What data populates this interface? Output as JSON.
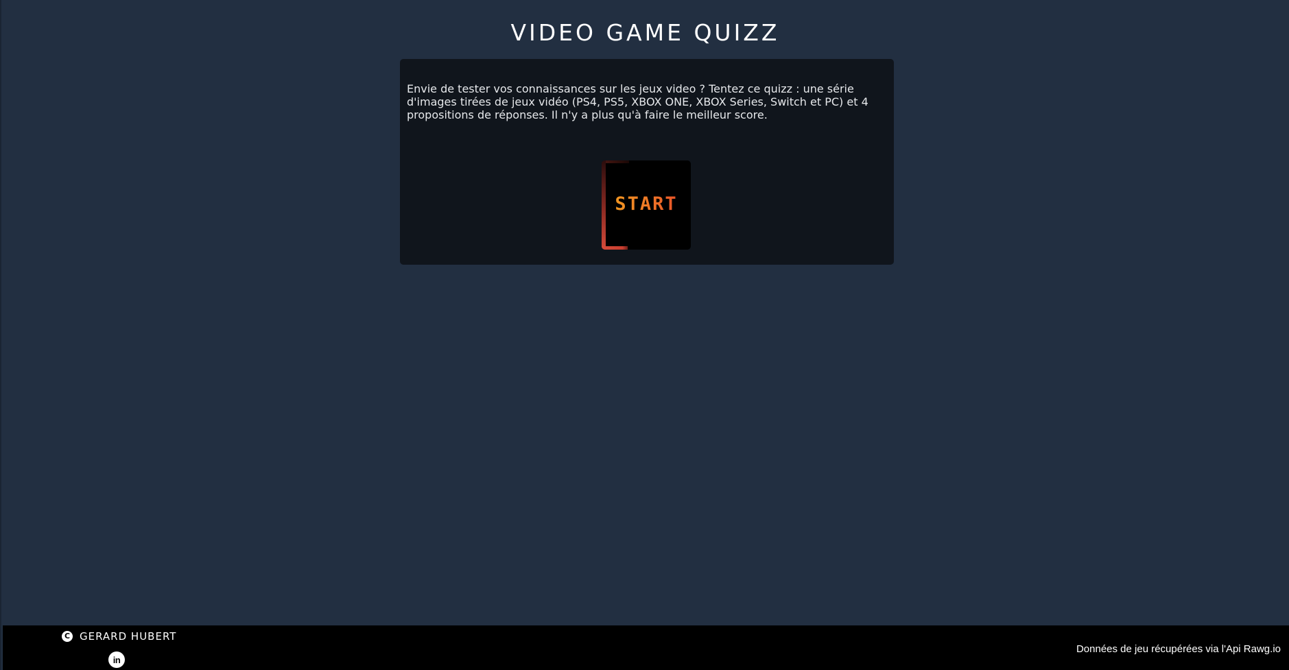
{
  "header": {
    "title": "VIDEO GAME QUIZZ"
  },
  "intro": {
    "text": "Envie de tester vos connaissances sur les jeux video ? Tentez ce quizz : une série d'images tirées de jeux vidéo (PS4, PS5, XBOX ONE, XBOX Series, Switch et PC) et 4 propositions de réponses. Il n'y a plus qu'à faire le meilleur score."
  },
  "start_button": {
    "label": "START"
  },
  "footer": {
    "copyright_symbol": "C",
    "author": "GERARD HUBERT",
    "linkedin_glyph": "in",
    "credits": "Données de jeu récupérées via l'Api Rawg.io"
  },
  "colors": {
    "background": "#222f41",
    "card": "#10151c",
    "footer": "#000000",
    "start_gradient": [
      "#f0a020",
      "#e8452a"
    ]
  },
  "icons": {
    "copyright": "copyright-icon",
    "linkedin": "linkedin-icon"
  }
}
